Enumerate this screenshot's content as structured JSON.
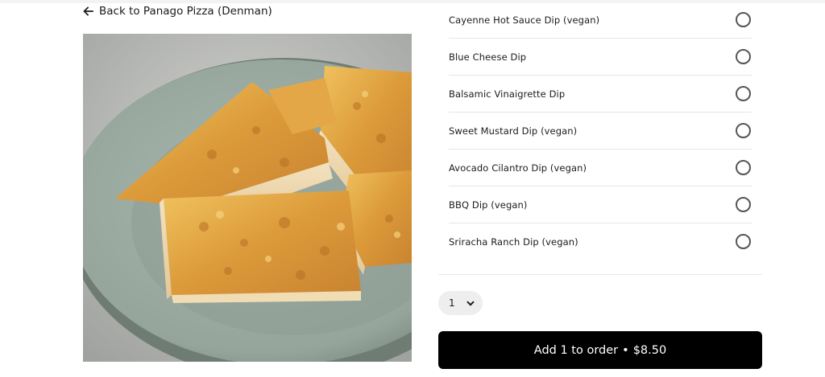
{
  "nav": {
    "back_label": "Back to Panago Pizza (Denman)",
    "back_icon": "arrow-left-icon"
  },
  "product_image": {
    "alt": "Cheese bread"
  },
  "dips": {
    "options": [
      {
        "label": "Cayenne Hot Sauce Dip (vegan)",
        "selected": false
      },
      {
        "label": "Blue Cheese Dip",
        "selected": false
      },
      {
        "label": "Balsamic Vinaigrette Dip",
        "selected": false
      },
      {
        "label": "Sweet Mustard Dip (vegan)",
        "selected": false
      },
      {
        "label": "Avocado Cilantro Dip (vegan)",
        "selected": false
      },
      {
        "label": "BBQ Dip (vegan)",
        "selected": false
      },
      {
        "label": "Sriracha Ranch Dip (vegan)",
        "selected": false
      }
    ]
  },
  "quantity": {
    "value": "1",
    "icon": "chevron-down-icon"
  },
  "add_button": {
    "label": "Add 1 to order",
    "separator": "•",
    "price": "$8.50"
  },
  "colors": {
    "button_bg": "#000000",
    "button_text": "#ffffff",
    "quantity_bg": "#eeeeee",
    "divider": "#e6e6e6"
  }
}
